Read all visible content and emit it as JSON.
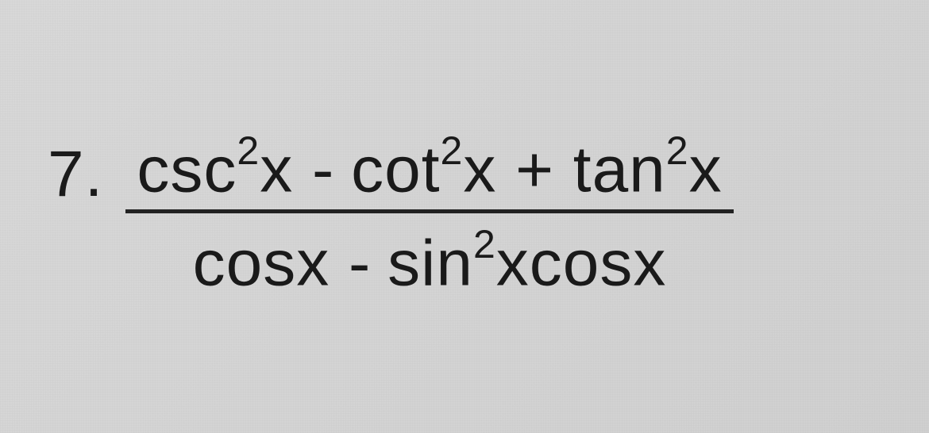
{
  "problem": {
    "number": "7.",
    "numerator_terms": {
      "t1": "csc",
      "e1": "2",
      "v1": "x",
      "op1": "-",
      "t2": "cot",
      "e2": "2",
      "v2": "x",
      "op2": "+",
      "t3": "tan",
      "e3": "2",
      "v3": "x"
    },
    "denominator_terms": {
      "t1": "cosx",
      "op1": "-",
      "t2": "sin",
      "e2": "2",
      "v2": "xcosx"
    }
  }
}
